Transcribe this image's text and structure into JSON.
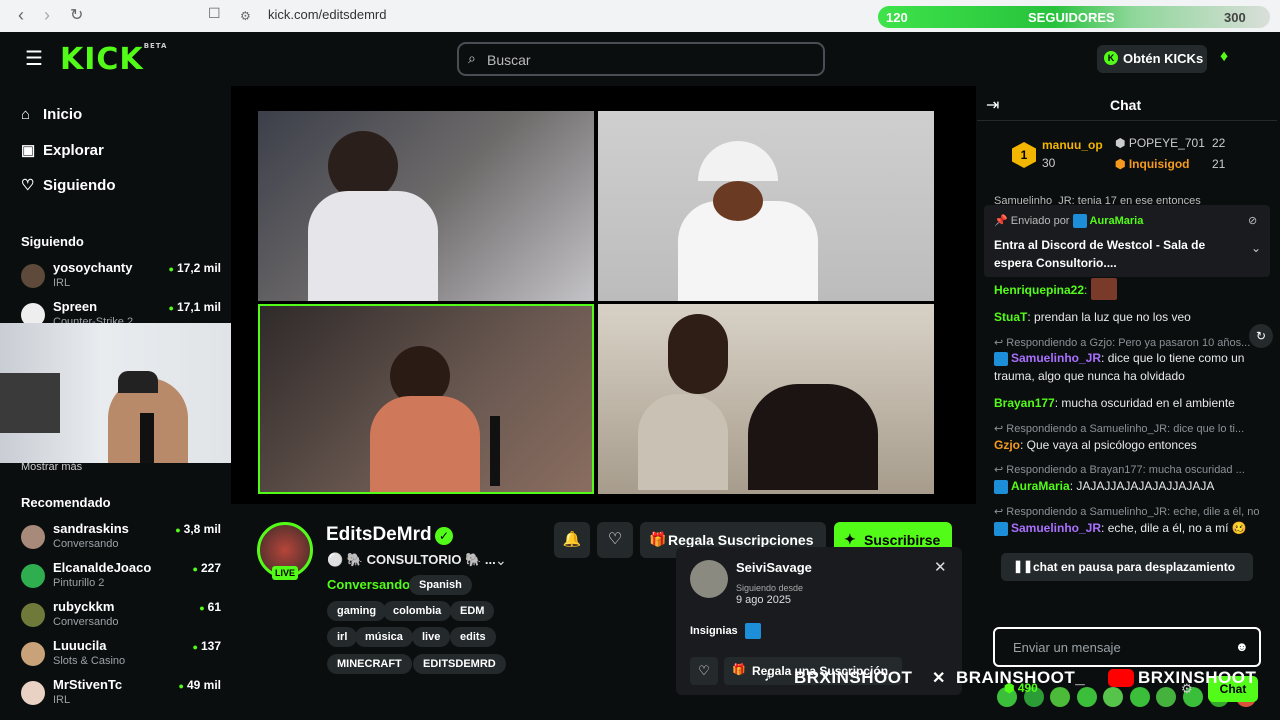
{
  "browser": {
    "url": "kick.com/editsdemrd",
    "follow_count": "120",
    "follow_label": "SEGUIDORES",
    "follow_goal": "300"
  },
  "header": {
    "logo": "KICK",
    "logo_sup": "BETA",
    "search_placeholder": "Buscar",
    "get_kicks": "Obtén KICKs"
  },
  "sidebar": {
    "nav": [
      "Inicio",
      "Explorar",
      "Siguiendo"
    ],
    "following_title": "Siguiendo",
    "following": [
      {
        "name": "yosoychanty",
        "category": "IRL",
        "viewers": "17,2 mil"
      },
      {
        "name": "Spreen",
        "category": "Counter-Strike 2",
        "viewers": "17,1 mil"
      }
    ],
    "show_more": "Mostrar más",
    "recommended_title": "Recomendado",
    "recommended": [
      {
        "name": "sandraskins",
        "category": "Conversando",
        "viewers": "3,8 mil"
      },
      {
        "name": "ElcanaldeJoaco",
        "category": "Pinturillo 2",
        "viewers": "227"
      },
      {
        "name": "rubyckkm",
        "category": "Conversando",
        "viewers": "61"
      },
      {
        "name": "Luuucila",
        "category": "Slots & Casino",
        "viewers": "137"
      },
      {
        "name": "MrStivenTc",
        "category": "IRL",
        "viewers": "49 mil"
      }
    ]
  },
  "channel": {
    "name": "EditsDeMrd",
    "live_badge": "LIVE",
    "title": "⚪ 🐘 CONSULTORIO 🐘 ...",
    "category": "Conversando",
    "language": "Spanish",
    "tags": [
      "gaming",
      "colombia",
      "EDM",
      "irl",
      "música",
      "live",
      "edits",
      "MINECRAFT",
      "EDITSDEMRD"
    ],
    "gift_subs": "Regala Suscripciones",
    "subscribe": "Suscribirse"
  },
  "popup": {
    "user": "SeiviSavage",
    "following_since_label": "Siguiendo desde",
    "following_since_date": "9 ago 2025",
    "badges_label": "Insignias",
    "gift_button": "Regala una Suscripción"
  },
  "chat": {
    "title": "Chat",
    "leaderboard": [
      {
        "rank": "1",
        "name": "manuu_op",
        "count": "30"
      },
      {
        "name": "POPEYE_701",
        "count": "22"
      },
      {
        "name": "Inquisigod",
        "count": "21"
      }
    ],
    "pinned_partial": "Samuelinho_JR: tenia 17 en ese entonces",
    "pinned_by_label": "Enviado por",
    "pinned_by": "AuraMaria",
    "pinned_text": "Entra al Discord de Westcol - Sala de espera Consultorio....",
    "messages": [
      {
        "user": "Henriquepina22",
        "text": ""
      },
      {
        "user": "StuaT",
        "text": "prendan la luz que no los veo"
      },
      {
        "reply": "Respondiendo a Gzjo: Pero ya pasaron 10 años...",
        "user": "Samuelinho_JR",
        "text": "dice que lo tiene como un trauma, algo que nunca ha olvidado"
      },
      {
        "user": "Brayan177",
        "text": "mucha oscuridad en el ambiente"
      },
      {
        "reply": "Respondiendo a Samuelinho_JR: dice que lo ti...",
        "user": "Gzjo",
        "text": "Que vaya al psicólogo entonces"
      },
      {
        "reply": "Respondiendo a Brayan177: mucha oscuridad ...",
        "user": "AuraMaria",
        "text": "JAJAJJAJAJAJAJJAJAJA"
      },
      {
        "reply": "Respondiendo a Samuelinho_JR: eche, dile a él, no a mí",
        "user": "Samuelinho_JR",
        "text": "eche, dile a él, no a mí 🥴"
      }
    ],
    "paused": "chat en pausa para desplazamiento",
    "input_placeholder": "Enviar un mensaje",
    "points": "490",
    "send_button": "Chat"
  },
  "overlay": {
    "tiktok": "BRXINSHOOT",
    "x": "BRAINSHOOT_",
    "youtube": "BRXINSHOOT"
  },
  "colors": {
    "accent": "#53fc18",
    "background": "#0b0e0f",
    "surface": "#24292c"
  }
}
